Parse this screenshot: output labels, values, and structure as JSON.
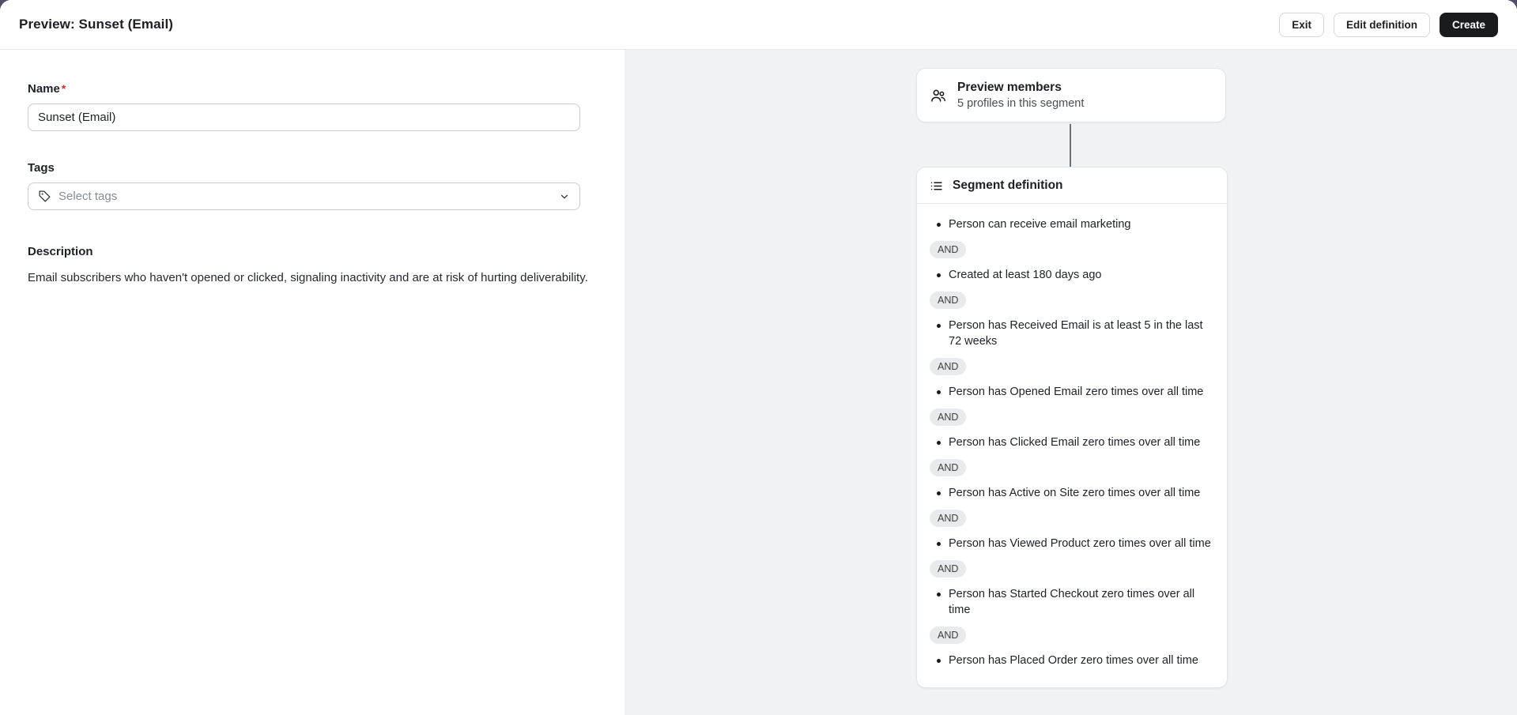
{
  "header": {
    "title": "Preview: Sunset (Email)",
    "buttons": {
      "exit": "Exit",
      "edit_definition": "Edit definition",
      "create": "Create"
    }
  },
  "form": {
    "name": {
      "label": "Name",
      "required_mark": "*",
      "value": "Sunset (Email)"
    },
    "tags": {
      "label": "Tags",
      "placeholder": "Select tags"
    },
    "description": {
      "label": "Description",
      "text": "Email subscribers who haven't opened or clicked, signaling inactivity and are at risk of hurting deliverability."
    }
  },
  "preview_members": {
    "title": "Preview members",
    "subtitle": "5 profiles in this segment",
    "icon": "users-icon"
  },
  "segment_definition": {
    "title": "Segment definition",
    "icon": "list-icon",
    "operator": "AND",
    "conditions": [
      "Person can receive email marketing",
      "Created at least 180 days ago",
      "Person has Received Email is at least 5 in the last 72 weeks",
      "Person has Opened Email zero times over all time",
      "Person has Clicked Email zero times over all time",
      "Person has Active on Site zero times over all time",
      "Person has Viewed Product zero times over all time",
      "Person has Started Checkout zero times over all time",
      "Person has Placed Order zero times over all time"
    ]
  },
  "colors": {
    "backdrop": "#514f66",
    "canvas_gray": "#f1f2f4",
    "primary_button_bg": "#191b1f",
    "required_red": "#d92b2b",
    "pill_bg": "#e9eaed",
    "connector": "#6d7177"
  }
}
